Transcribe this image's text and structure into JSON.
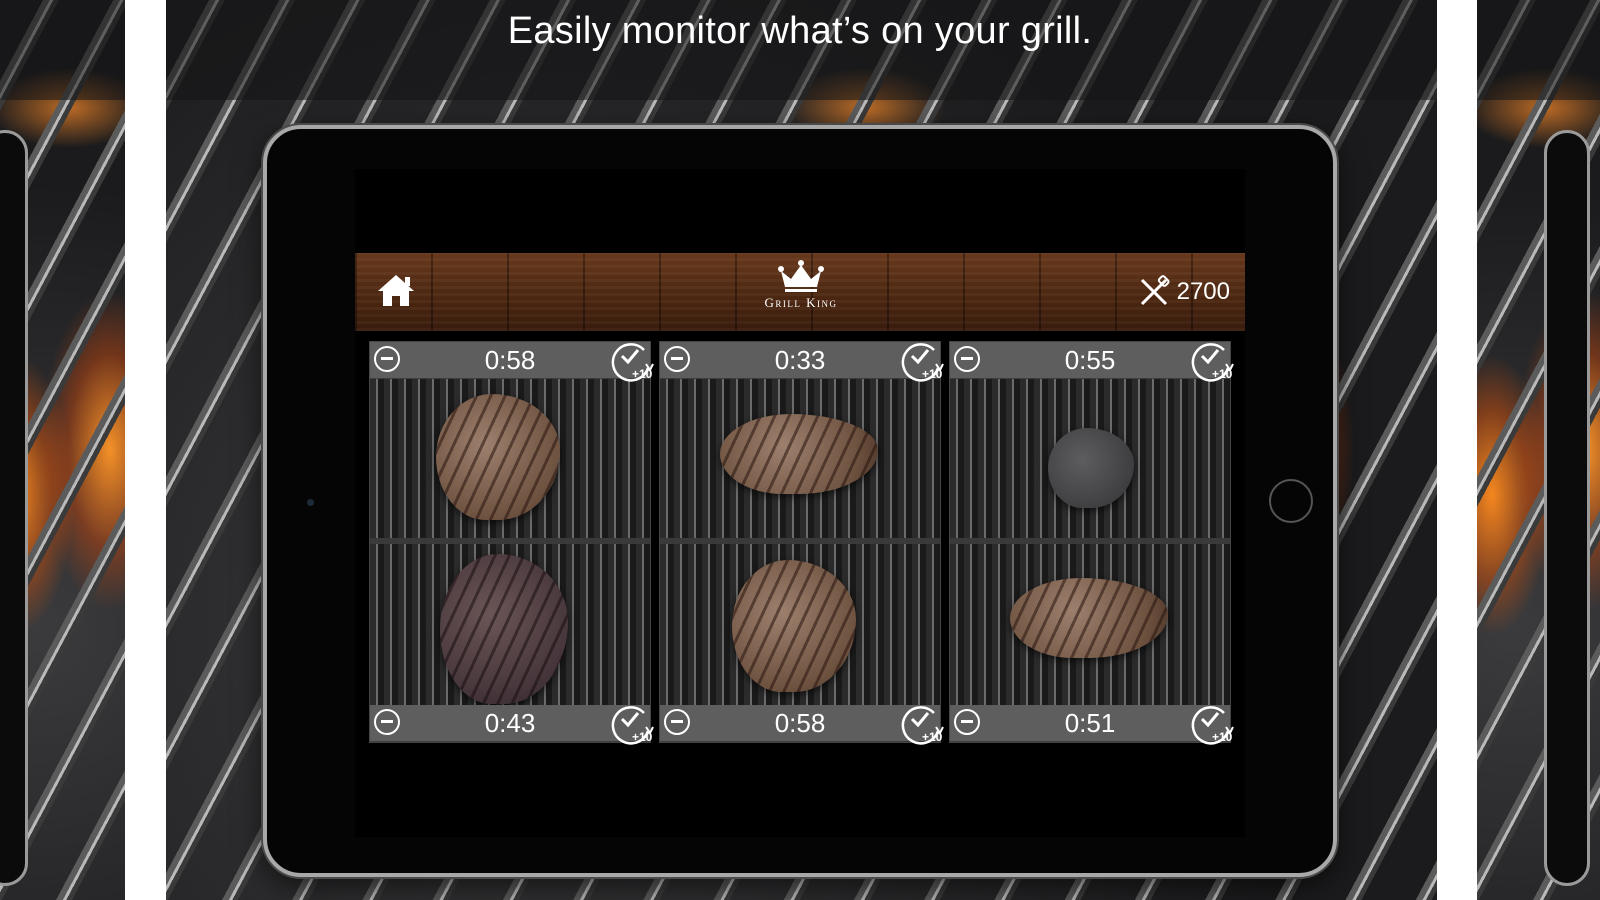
{
  "headline": "Easily monitor what’s on your grill.",
  "app": {
    "logo_text": "Grill King",
    "score": "2700",
    "home_icon": "home-icon",
    "logo_icon": "crown-icon",
    "score_icon": "crossed-utensils-icon"
  },
  "grills": [
    {
      "top": {
        "time": "0:58",
        "item": "t-bone-steak"
      },
      "bottom": {
        "time": "0:43",
        "item": "dark-steak"
      }
    },
    {
      "top": {
        "time": "0:33",
        "item": "grilled-steak"
      },
      "bottom": {
        "time": "0:58",
        "item": "t-bone-steak"
      }
    },
    {
      "top": {
        "time": "0:55",
        "item": "seasoned-steak"
      },
      "bottom": {
        "time": "0:51",
        "item": "grilled-steak"
      }
    }
  ],
  "timer_controls": {
    "remove_icon": "minus-circle-icon",
    "add_icon": "clock-plus-icon",
    "add_label": "+10"
  }
}
